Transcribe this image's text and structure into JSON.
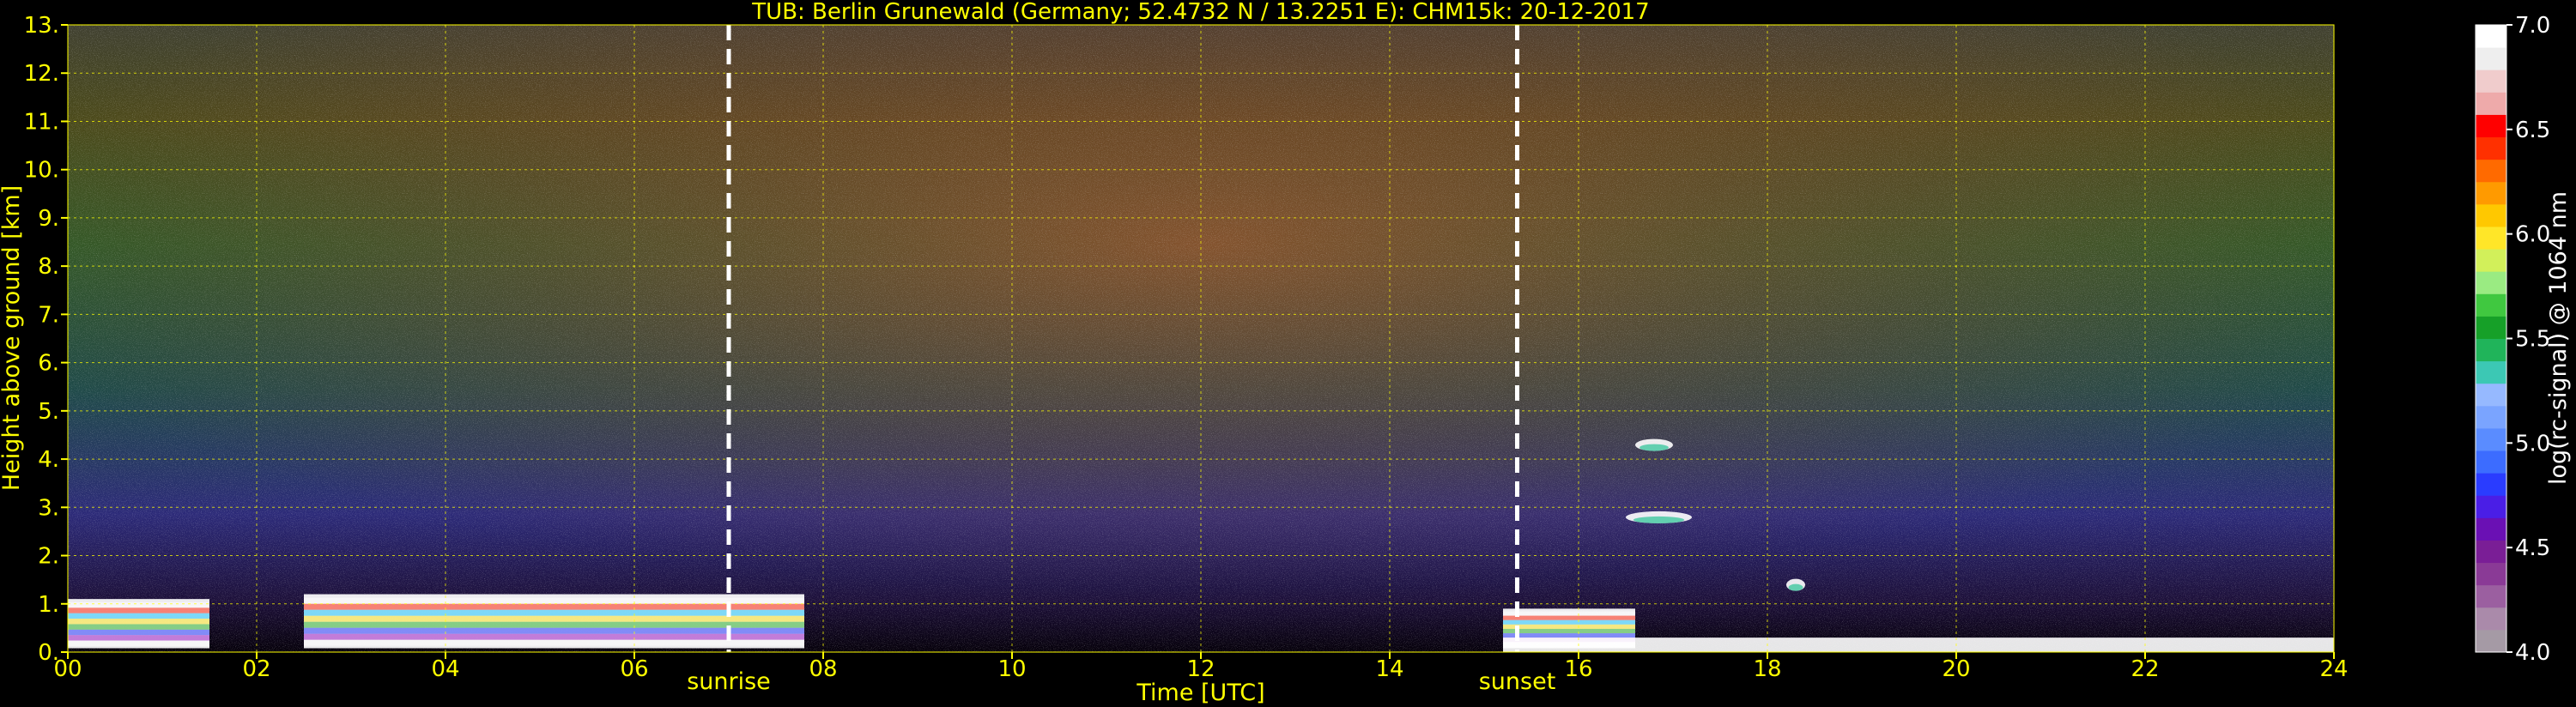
{
  "chart_data": {
    "type": "heatmap",
    "title": "TUB: Berlin Grunewald (Germany; 52.4732 N / 13.2251 E):    CHM15k: 20-12-2017",
    "xlabel": "Time [UTC]",
    "ylabel": "Height above ground [km]",
    "colorbar_label": "log(rc-signal) @ 1064 nm",
    "xlim": [
      0,
      24
    ],
    "ylim": [
      0,
      13
    ],
    "clim": [
      4.0,
      7.0
    ],
    "x_ticks": [
      0,
      2,
      4,
      6,
      8,
      10,
      12,
      14,
      16,
      18,
      20,
      22,
      24
    ],
    "x_tick_labels": [
      "00",
      "02",
      "04",
      "06",
      "08",
      "10",
      "12",
      "14",
      "16",
      "18",
      "20",
      "22",
      "24"
    ],
    "y_ticks": [
      0,
      1,
      2,
      3,
      4,
      5,
      6,
      7,
      8,
      9,
      10,
      11,
      12,
      13
    ],
    "y_tick_labels": [
      "0.",
      "1.",
      "2.",
      "3.",
      "4.",
      "5.",
      "6.",
      "7.",
      "8.",
      "9.",
      "10.",
      "11.",
      "12.",
      "13."
    ],
    "colorbar_ticks": [
      4.0,
      4.5,
      5.0,
      5.5,
      6.0,
      6.5,
      7.0
    ],
    "colorbar_tick_labels": [
      "4.0",
      "4.5",
      "5.0",
      "5.5",
      "6.0",
      "6.5",
      "7.0"
    ],
    "grid": true,
    "annotations": [
      {
        "label": "sunrise",
        "time": 7.0
      },
      {
        "label": "sunset",
        "time": 15.35
      }
    ],
    "features": [
      {
        "kind": "boundary layer",
        "t_start": 0.0,
        "t_end": 1.5,
        "top_km": 1.1
      },
      {
        "kind": "boundary layer",
        "t_start": 2.5,
        "t_end": 7.8,
        "top_km": 1.2
      },
      {
        "kind": "boundary layer",
        "t_start": 15.2,
        "t_end": 16.6,
        "top_km": 0.9
      },
      {
        "kind": "cloud",
        "t_start": 16.6,
        "t_end": 17.0,
        "top_km": 4.4
      },
      {
        "kind": "cloud",
        "t_start": 16.5,
        "t_end": 17.2,
        "top_km": 2.9
      },
      {
        "kind": "cloud",
        "t_start": 18.2,
        "t_end": 18.4,
        "top_km": 1.5
      }
    ],
    "colormap": [
      "#a59aa5",
      "#aa8aaa",
      "#9b5fa0",
      "#8a3a96",
      "#7a1e96",
      "#6a10b4",
      "#4a1ee6",
      "#2a3cff",
      "#3c6cff",
      "#5a8cff",
      "#7aa4ff",
      "#96b9ff",
      "#3cc8b4",
      "#20b45a",
      "#16a028",
      "#40c840",
      "#9aeb82",
      "#d2f05a",
      "#ffe628",
      "#ffc800",
      "#ff9a00",
      "#ff6a00",
      "#ff3000",
      "#ff0000",
      "#eeaaaa",
      "#f0cccc",
      "#eeeeee",
      "#ffffff"
    ]
  }
}
